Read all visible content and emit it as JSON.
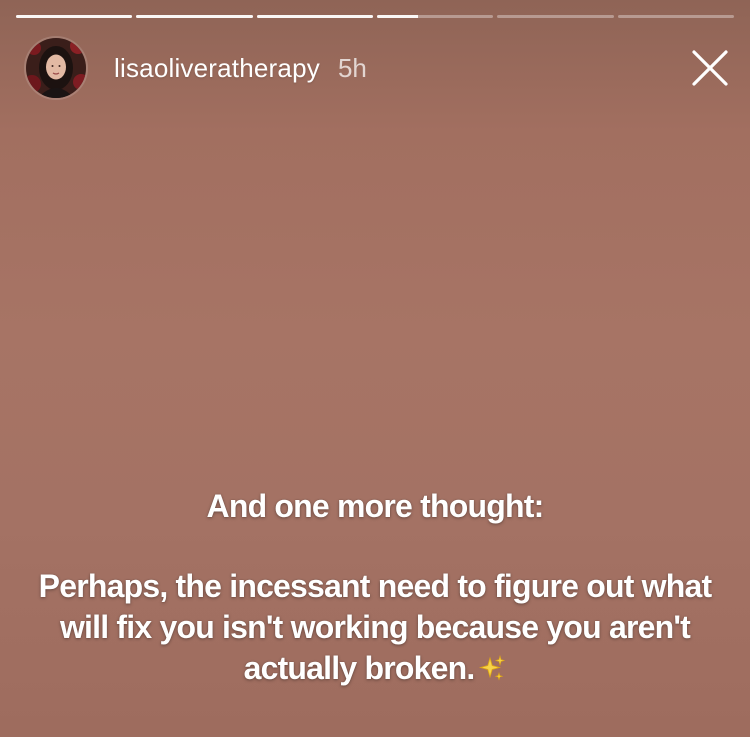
{
  "progress": {
    "segments": [
      1,
      1,
      1,
      0.35,
      0,
      0
    ]
  },
  "header": {
    "username": "lisaoliveratherapy",
    "timestamp": "5h",
    "avatar_icon": "profile-photo"
  },
  "close_icon": "close-icon",
  "story": {
    "heading": "And one more thought:",
    "body": "Perhaps, the incessant need to figure out what will fix you isn't working because you aren't actually broken.",
    "emoji": "sparkles-icon"
  }
}
